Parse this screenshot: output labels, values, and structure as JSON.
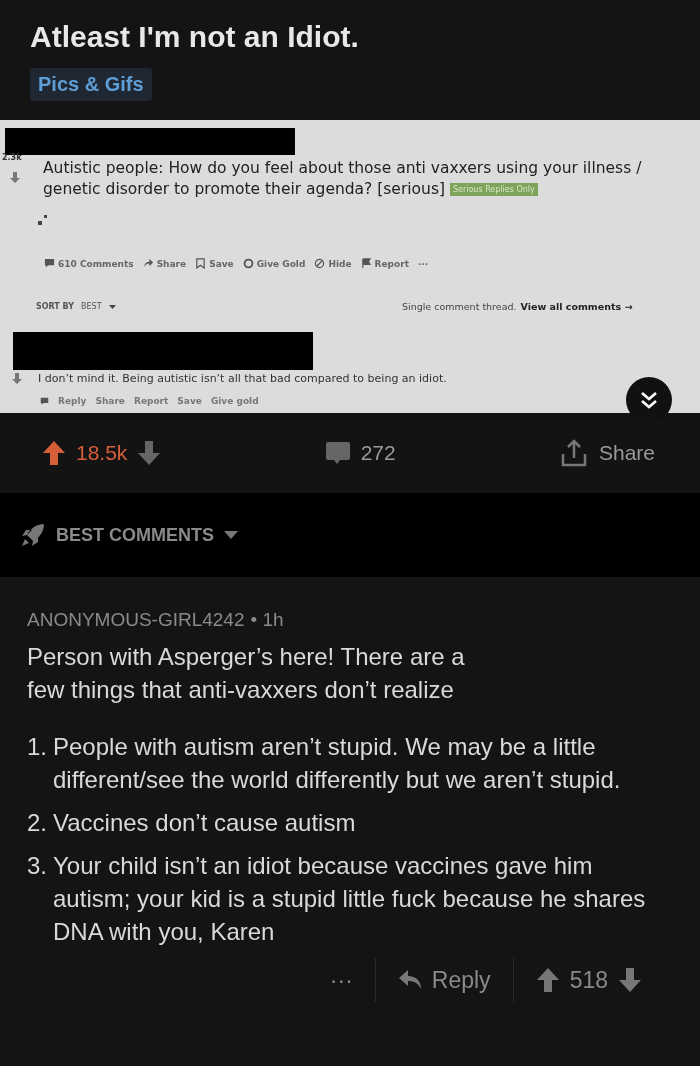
{
  "post": {
    "title": "Atleast I'm not an Idiot.",
    "flair": "Pics & Gifs"
  },
  "embedded_screenshot": {
    "score": "2.3k",
    "title": "Autistic people: How do you feel about those anti vaxxers using your illness / genetic disorder to promote their agenda? [serious]",
    "flair": "Serious Replies Only",
    "actions": [
      {
        "kind": "comment",
        "label": "610 Comments"
      },
      {
        "kind": "share",
        "label": "Share"
      },
      {
        "kind": "save",
        "label": "Save"
      },
      {
        "kind": "gold",
        "label": "Give Gold"
      },
      {
        "kind": "hide",
        "label": "Hide"
      },
      {
        "kind": "report",
        "label": "Report"
      },
      {
        "kind": "more",
        "label": "···"
      }
    ],
    "sort_label": "SORT BY",
    "sort_value": "BEST",
    "thread_note": "Single comment thread.",
    "view_all": "View all comments →",
    "comment": {
      "body": "I don’t mind it. Being autistic isn’t all that bad compared to being an idiot.",
      "actions": [
        "Reply",
        "Share",
        "Report",
        "Save",
        "Give gold"
      ]
    }
  },
  "vote_bar": {
    "score": "18.5k",
    "upvoted": true,
    "comments": "272",
    "share": "Share"
  },
  "comments_header": {
    "label": "BEST COMMENTS"
  },
  "comment": {
    "author": "ANONYMOUS-GIRL4242",
    "time": "• 1h",
    "intro": "Person with Asperger’s here! There are a few things that anti-vaxxers don’t realize",
    "points": [
      {
        "number": "1.",
        "text": "People with autism aren’t stupid. We may be a little different/see the world differently but we aren’t stupid."
      },
      {
        "number": "2.",
        "text": "Vaccines don’t cause autism"
      },
      {
        "number": "3.",
        "text": "Your child isn’t an idiot because vaccines gave him autism; your kid is a stupid little fuck because he shares DNA with you, Karen"
      }
    ],
    "more": "···",
    "reply": "Reply",
    "score": "518"
  }
}
